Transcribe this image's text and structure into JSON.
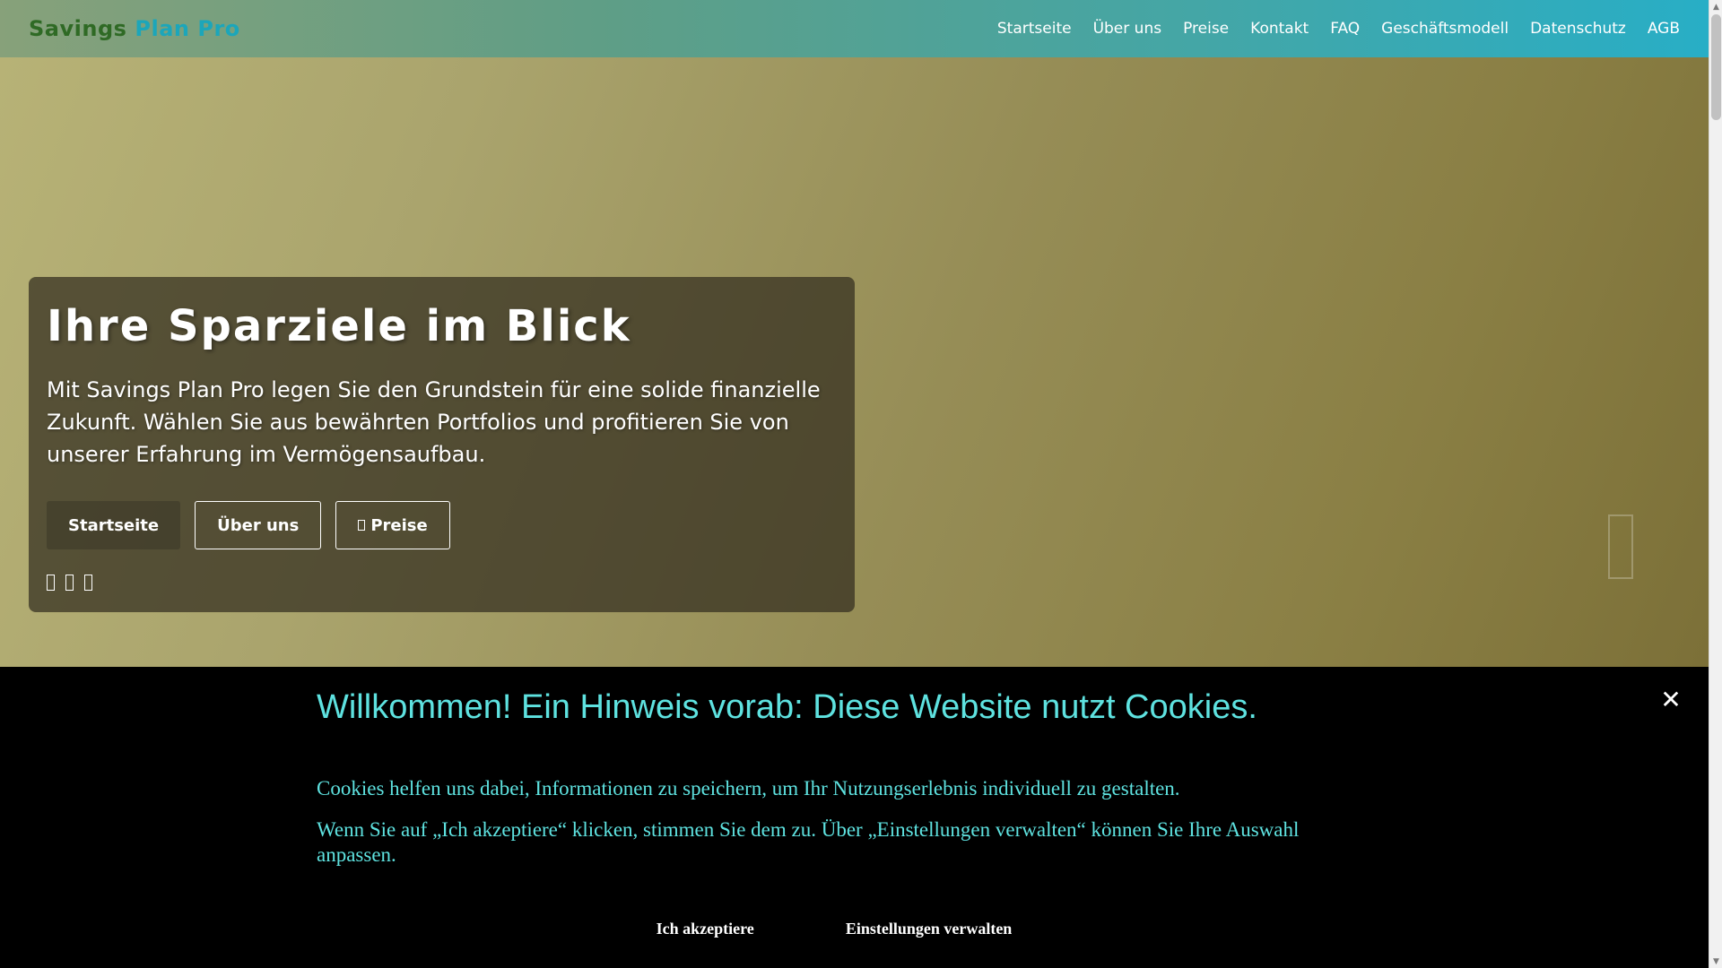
{
  "header": {
    "brand_part1": "Savings",
    "brand_part2": "Plan Pro",
    "nav": [
      {
        "label": "Startseite"
      },
      {
        "label": "Über uns"
      },
      {
        "label": "Preise"
      },
      {
        "label": "Kontakt"
      },
      {
        "label": "FAQ"
      },
      {
        "label": "Geschäftsmodell"
      },
      {
        "label": "Datenschutz"
      },
      {
        "label": "AGB"
      }
    ]
  },
  "hero": {
    "title": "Ihre Sparziele im Blick",
    "text": "Mit Savings Plan Pro legen Sie den Grundstein für eine solide finanzielle Zukunft. Wählen Sie aus bewährten Portfolios und profitieren Sie von unserer Erfahrung im Vermögensaufbau.",
    "buttons": [
      {
        "label": "Startseite"
      },
      {
        "label": "Über uns"
      },
      {
        "label": "Preise",
        "icon": "tag-icon"
      }
    ],
    "social_icons": [
      "facebook-icon",
      "twitter-icon",
      "instagram-icon"
    ],
    "carousel_next_icon": "chevron-right-icon"
  },
  "cookie_banner": {
    "title": "Willkommen! Ein Hinweis vorab: Diese Website nutzt Cookies.",
    "paragraph1": "Cookies helfen uns dabei, Informationen zu speichern, um Ihr Nutzungserlebnis individuell zu gestalten.",
    "paragraph2": "Wenn Sie auf „Ich akzeptiere“ klicken, stimmen Sie dem zu. Über „Einstellungen verwalten“ können Sie Ihre Auswahl anpassen.",
    "accept_label": "Ich akzeptiere",
    "settings_label": "Einstellungen verwalten",
    "close_glyph": "✕"
  },
  "colors": {
    "header_gradient": [
      "#87a17a",
      "#28aec6"
    ],
    "brand_green": "#2f6a25",
    "brand_teal": "#1ca6ba",
    "cookie_text": "#5ee2e0",
    "cookie_bg": "#000000"
  }
}
